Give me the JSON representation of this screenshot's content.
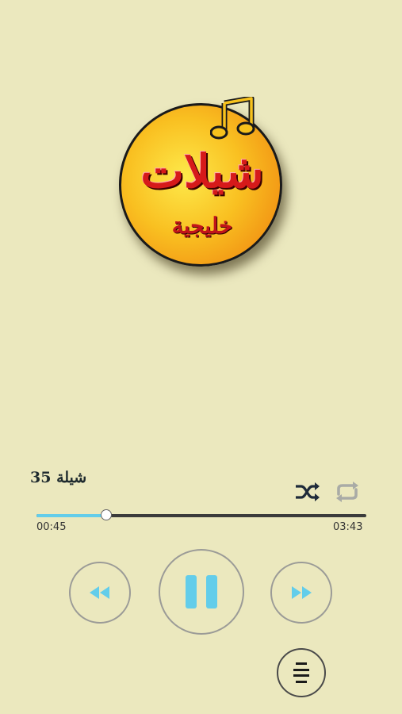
{
  "logo": {
    "main_text": "شيلات",
    "sub_text": "خليجية"
  },
  "player": {
    "track_title": "شيلة 35",
    "current_time": "00:45",
    "total_time": "03:43",
    "progress_fraction": 0.21,
    "shuffle_icon": "shuffle-icon",
    "repeat_icon": "repeat-icon",
    "state": "playing"
  },
  "colors": {
    "background": "#ebe8be",
    "accent": "#63cdea",
    "track_bar": "#3b3b3b",
    "button_ring": "#9b9b97"
  },
  "icons": {
    "prev": "rewind-icon",
    "play_pause": "pause-icon",
    "next": "fast-forward-icon",
    "playlist": "playlist-icon"
  }
}
